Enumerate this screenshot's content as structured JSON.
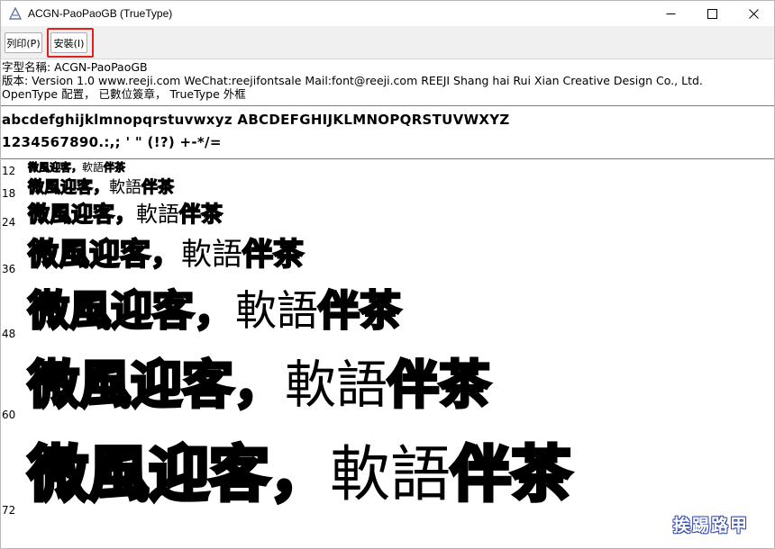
{
  "window": {
    "title": "ACGN-PaoPaoGB (TrueType)"
  },
  "toolbar": {
    "print_label": "列印(P)",
    "install_label": "安裝(I)"
  },
  "info": {
    "font_name": "字型名稱: ACGN-PaoPaoGB",
    "version": "版本: Version 1.0 www.reeji.com WeChat:reejifontsale Mail:font@reeji.com REEJI Shang hai Rui Xian Creative Design Co., Ltd.",
    "opentype": "OpenType 配置， 已數位簽章， TrueType 外框"
  },
  "charset": {
    "line1": "abcdefghijklmnopqrstuvwxyz ABCDEFGHIJKLMNOPQRSTUVWXYZ",
    "line2": "1234567890.:,; ' \" (!?) +-*/="
  },
  "samples": [
    {
      "size": "12",
      "bubble_text": "微風迎客，",
      "serif_text": "軟語",
      "tail_text": "伴茶"
    },
    {
      "size": "18",
      "bubble_text": "微風迎客，",
      "serif_text": "軟語",
      "tail_text": "伴茶"
    },
    {
      "size": "24",
      "bubble_text": "微風迎客，",
      "serif_text": "軟語",
      "tail_text": "伴茶"
    },
    {
      "size": "36",
      "bubble_text": "微風迎客，",
      "serif_text": "軟語",
      "tail_text": "伴茶"
    },
    {
      "size": "48",
      "bubble_text": "微風迎客，",
      "serif_text": "軟語",
      "tail_text": "伴茶"
    },
    {
      "size": "60",
      "bubble_text": "微風迎客，",
      "serif_text": "軟語",
      "tail_text": "伴茶"
    },
    {
      "size": "72",
      "bubble_text": "微風迎客，",
      "serif_text": "軟語",
      "tail_text": "伴茶"
    }
  ],
  "watermark": "挨踢路甲",
  "icons": {
    "app": "font-app-icon",
    "minimize": "minimize-icon",
    "maximize": "maximize-icon",
    "close": "close-icon"
  },
  "colors": {
    "highlight": "#e0201c",
    "watermark": "#3a4fb0"
  }
}
